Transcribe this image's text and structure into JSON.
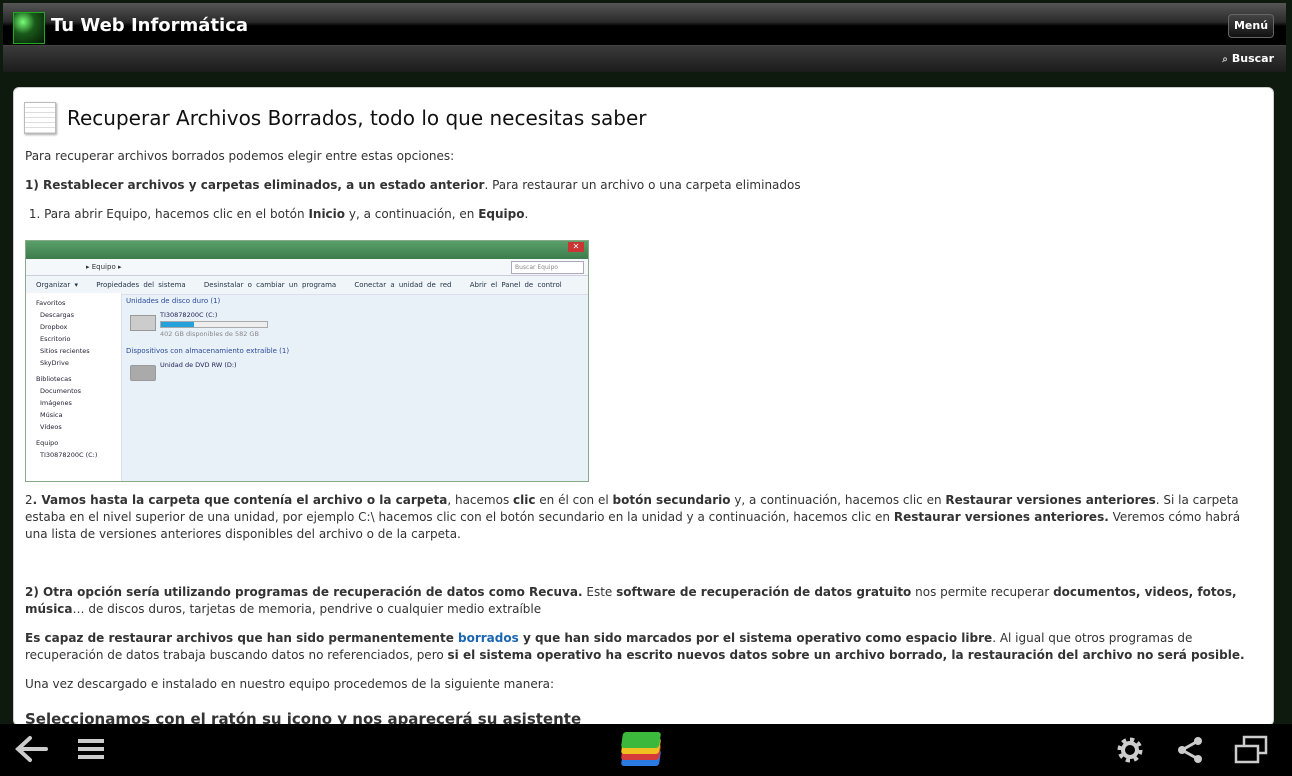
{
  "header": {
    "site_title": "Tu Web Informática",
    "menu_label": "Menú",
    "search_label": "Buscar"
  },
  "post": {
    "title": "Recuperar Archivos Borrados, todo lo que necesitas saber",
    "intro": "Para recuperar archivos borrados podemos elegir entre estas opciones:",
    "opt1_bold": "1) Restablecer archivos y carpetas eliminados, a un estado anterior",
    "opt1_rest": ". Para restaurar un archivo o una carpeta eliminados",
    "step1_pre": "1.  Para abrir Equipo, hacemos clic en el botón ",
    "step1_b1": "Inicio",
    "step1_mid": " y, a continuación, en ",
    "step1_b2": "Equipo",
    "step1_end": ".",
    "step2_num": "2",
    "step2_b1": ". Vamos hasta la carpeta que contenía el archivo o la carpeta",
    "step2_t1": ", hacemos ",
    "step2_b2": "clic",
    "step2_t2": " en él con el ",
    "step2_b3": "botón secundario",
    "step2_t3": " y, a continuación, hacemos clic en ",
    "step2_b4": "Restaurar versiones anteriores",
    "step2_t4": ". Si la carpeta estaba en el nivel superior de una unidad, por ejemplo C:\\ hacemos clic con el botón secundario en la unidad y a continuación, hacemos clic en ",
    "step2_b5": "Restaurar versiones anteriores.",
    "step2_t5": " Veremos cómo habrá una lista de versiones anteriores disponibles del archivo o de la carpeta.",
    "opt2_b1": "2) Otra opción sería utilizando programas de recuperación de datos como Recuva.",
    "opt2_t1": " Este ",
    "opt2_b2": "software de recuperación de datos gratuito",
    "opt2_t2": " nos permite recuperar ",
    "opt2_b3": "documentos, videos, fotos, música",
    "opt2_t3": "… de discos duros, tarjetas de memoria, pendrive o cualquier medio extraíble",
    "cap_b1": "Es capaz de restaurar archivos que han sido permanentemente ",
    "cap_link": "borrados",
    "cap_b2": " y que han sido marcados por el sistema operativo como espacio libre",
    "cap_t1": ". Al igual que otros programas de recuperación de datos trabaja buscando datos no referenciados, pero ",
    "cap_b3": "si el sistema operativo ha escrito nuevos datos sobre un archivo borrado, la restauración del archivo no será posible.",
    "install": "Una vez descargado e instalado en nuestro equipo procedemos de la siguiente manera:",
    "subheading": "Seleccionamos con el ratón su icono y nos aparecerá su asistente"
  },
  "screenshot": {
    "address": "Equipo",
    "search_placeholder": "Buscar Equipo",
    "toolbar": [
      "Organizar ▾",
      "Propiedades del sistema",
      "Desinstalar o cambiar un programa",
      "Conectar a unidad de red",
      "Abrir el Panel de control"
    ],
    "sidebar": [
      "Favoritos",
      "Descargas",
      "Dropbox",
      "Escritorio",
      "Sitios recientes",
      "SkyDrive",
      "Bibliotecas",
      "Documentos",
      "Imágenes",
      "Música",
      "Vídeos",
      "Equipo",
      "TI30878200C (C:)"
    ],
    "section_disks": "Unidades de disco duro (1)",
    "drive_c": "TI30878200C (C:)",
    "drive_c_free": "402 GB disponibles de 582 GB",
    "drive_c_used_fraction": 0.31,
    "section_removable": "Dispositivos con almacenamiento extraíble (1)",
    "drive_dvd": "Unidad de DVD RW (D:)"
  },
  "icons": {
    "logo": "site-logo",
    "search": "magnifier-icon",
    "back": "back-arrow-icon",
    "menu": "hamburger-icon",
    "center": "bluestacks-logo",
    "settings": "gear-icon",
    "share": "share-icon",
    "window": "multiwindow-icon"
  },
  "colors": {
    "link": "#1a66b0",
    "header_bg": "#000000"
  }
}
